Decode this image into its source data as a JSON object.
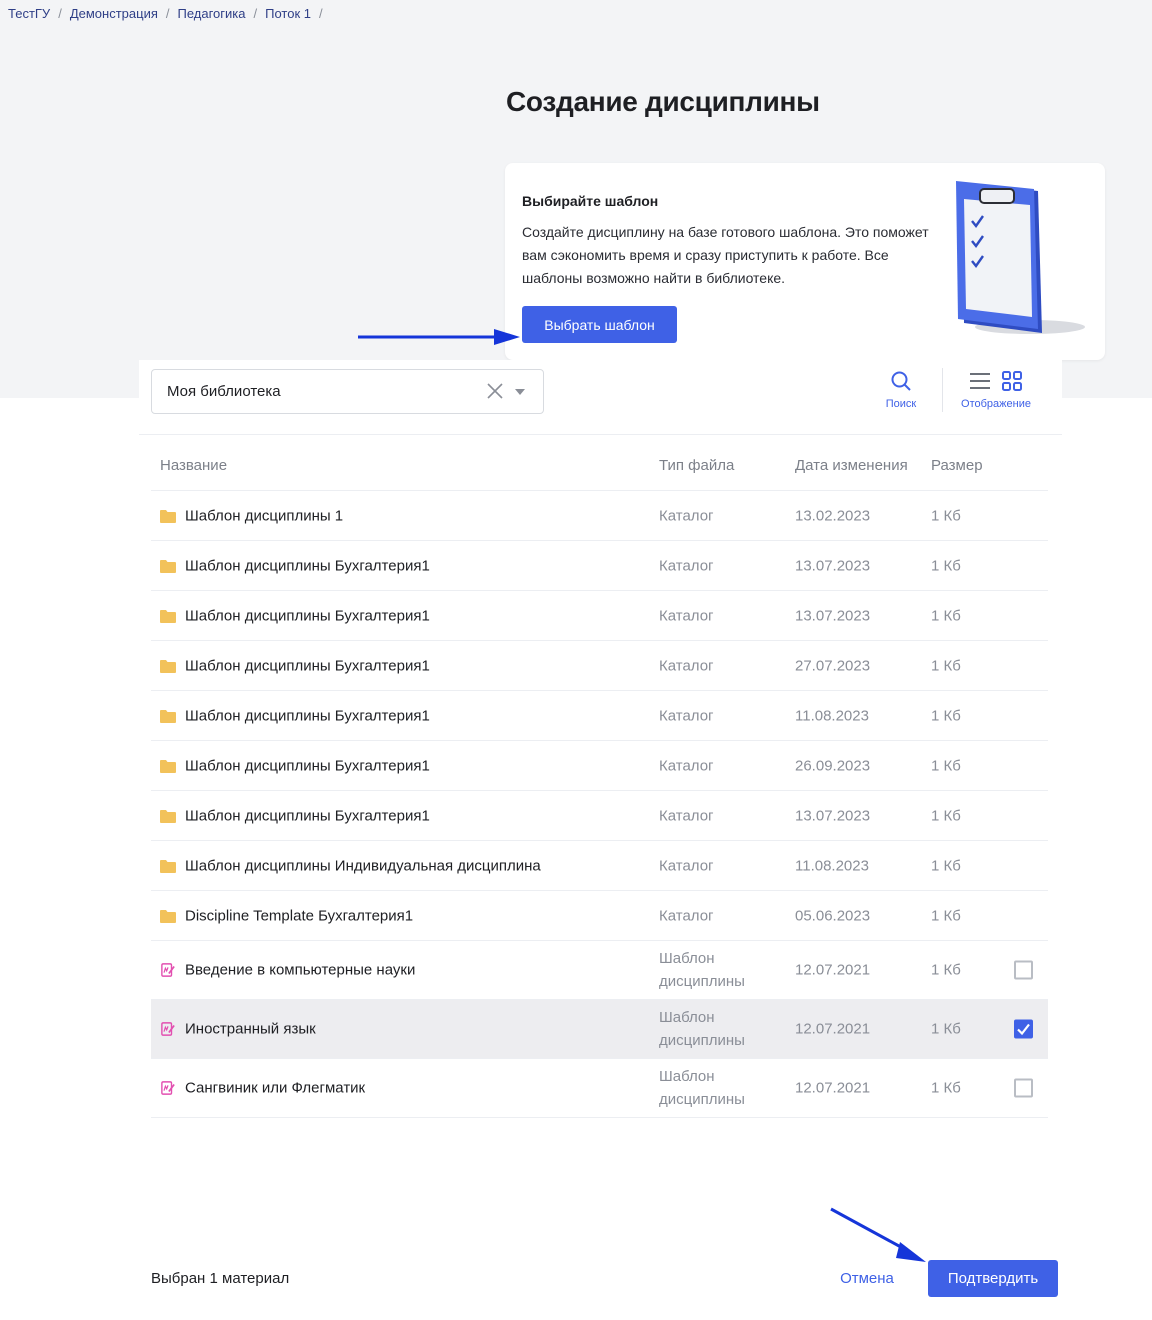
{
  "breadcrumb": [
    "ТестГУ",
    "Демонстрация",
    "Педагогика",
    "Поток 1"
  ],
  "breadcrumb_separator": "/",
  "page_title": "Создание дисциплины",
  "template_card": {
    "title": "Выбирайте шаблон",
    "text": "Создайте дисциплину на базе готового шаблона. Это поможет вам сэкономить время и сразу приступить к работе. Все шаблоны возможно найти в библиотеке.",
    "button_label": "Выбрать шаблон",
    "illustration_icon": "clipboard-checklist-icon"
  },
  "library_select": {
    "value": "Моя библиотека"
  },
  "toolbar": {
    "search_label": "Поиск",
    "view_label": "Отображение"
  },
  "table": {
    "columns": [
      "Название",
      "Тип файла",
      "Дата изменения",
      "Размер"
    ],
    "rows": [
      {
        "icon": "folder-icon",
        "name": "Шаблон дисциплины 1",
        "type": "Каталог",
        "date": "13.02.2023",
        "size": "1 Кб"
      },
      {
        "icon": "folder-icon",
        "name": "Шаблон дисциплины Бухгалтерия1",
        "type": "Каталог",
        "date": "13.07.2023",
        "size": "1 Кб"
      },
      {
        "icon": "folder-icon",
        "name": "Шаблон дисциплины Бухгалтерия1",
        "type": "Каталог",
        "date": "13.07.2023",
        "size": "1 Кб"
      },
      {
        "icon": "folder-icon",
        "name": "Шаблон дисциплины Бухгалтерия1",
        "type": "Каталог",
        "date": "27.07.2023",
        "size": "1 Кб"
      },
      {
        "icon": "folder-icon",
        "name": "Шаблон дисциплины Бухгалтерия1",
        "type": "Каталог",
        "date": "11.08.2023",
        "size": "1 Кб"
      },
      {
        "icon": "folder-icon",
        "name": "Шаблон дисциплины Бухгалтерия1",
        "type": "Каталог",
        "date": "26.09.2023",
        "size": "1 Кб"
      },
      {
        "icon": "folder-icon",
        "name": "Шаблон дисциплины Бухгалтерия1",
        "type": "Каталог",
        "date": "13.07.2023",
        "size": "1 Кб"
      },
      {
        "icon": "folder-icon",
        "name": "Шаблон дисциплины Индивидуальная дисциплина",
        "type": "Каталог",
        "date": "11.08.2023",
        "size": "1 Кб"
      },
      {
        "icon": "folder-icon",
        "name": "Discipline Template Бухгалтерия1",
        "type": "Каталог",
        "date": "05.06.2023",
        "size": "1 Кб"
      },
      {
        "icon": "template-icon",
        "name": "Введение в компьютерные науки",
        "type_line1": "Шаблон",
        "type_line2": "дисциплины",
        "date": "12.07.2021",
        "size": "1 Кб",
        "checked": false
      },
      {
        "icon": "template-icon",
        "name": "Иностранный язык",
        "type_line1": "Шаблон",
        "type_line2": "дисциплины",
        "date": "12.07.2021",
        "size": "1 Кб",
        "checked": true
      },
      {
        "icon": "template-icon",
        "name": "Сангвиник или Флегматик",
        "type_line1": "Шаблон",
        "type_line2": "дисциплины",
        "date": "12.07.2021",
        "size": "1 Кб",
        "checked": false
      }
    ]
  },
  "footer": {
    "selected_text": "Выбран 1 материал",
    "cancel_label": "Отмена",
    "confirm_label": "Подтвердить"
  },
  "colors": {
    "accent": "#3f61e6",
    "folder": "#f2c25a",
    "template_icon": "#e24fb0",
    "annotation_arrow": "#1535d9"
  }
}
